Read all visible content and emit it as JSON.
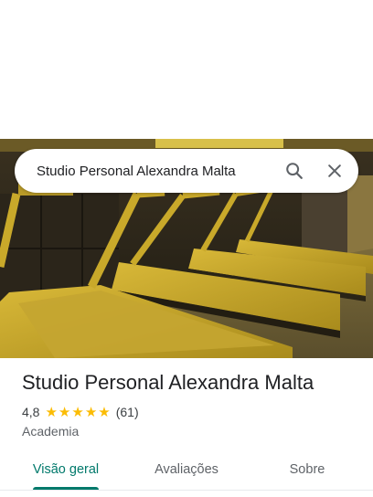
{
  "search": {
    "query": "Studio Personal Alexandra Malta",
    "search_icon": "search-icon",
    "close_icon": "close-icon"
  },
  "hero": {
    "description_icon": "gym-photo"
  },
  "place": {
    "title": "Studio Personal Alexandra Malta",
    "rating": "4,8",
    "stars": "★★★★★",
    "review_count": "(61)",
    "category": "Academia"
  },
  "tabs": [
    {
      "label": "Visão geral",
      "active": true
    },
    {
      "label": "Avaliações",
      "active": false
    },
    {
      "label": "Sobre",
      "active": false
    }
  ],
  "colors": {
    "accent": "#00796b",
    "star": "#fbbc04",
    "treadmill_yellow": "#c9a92a"
  }
}
